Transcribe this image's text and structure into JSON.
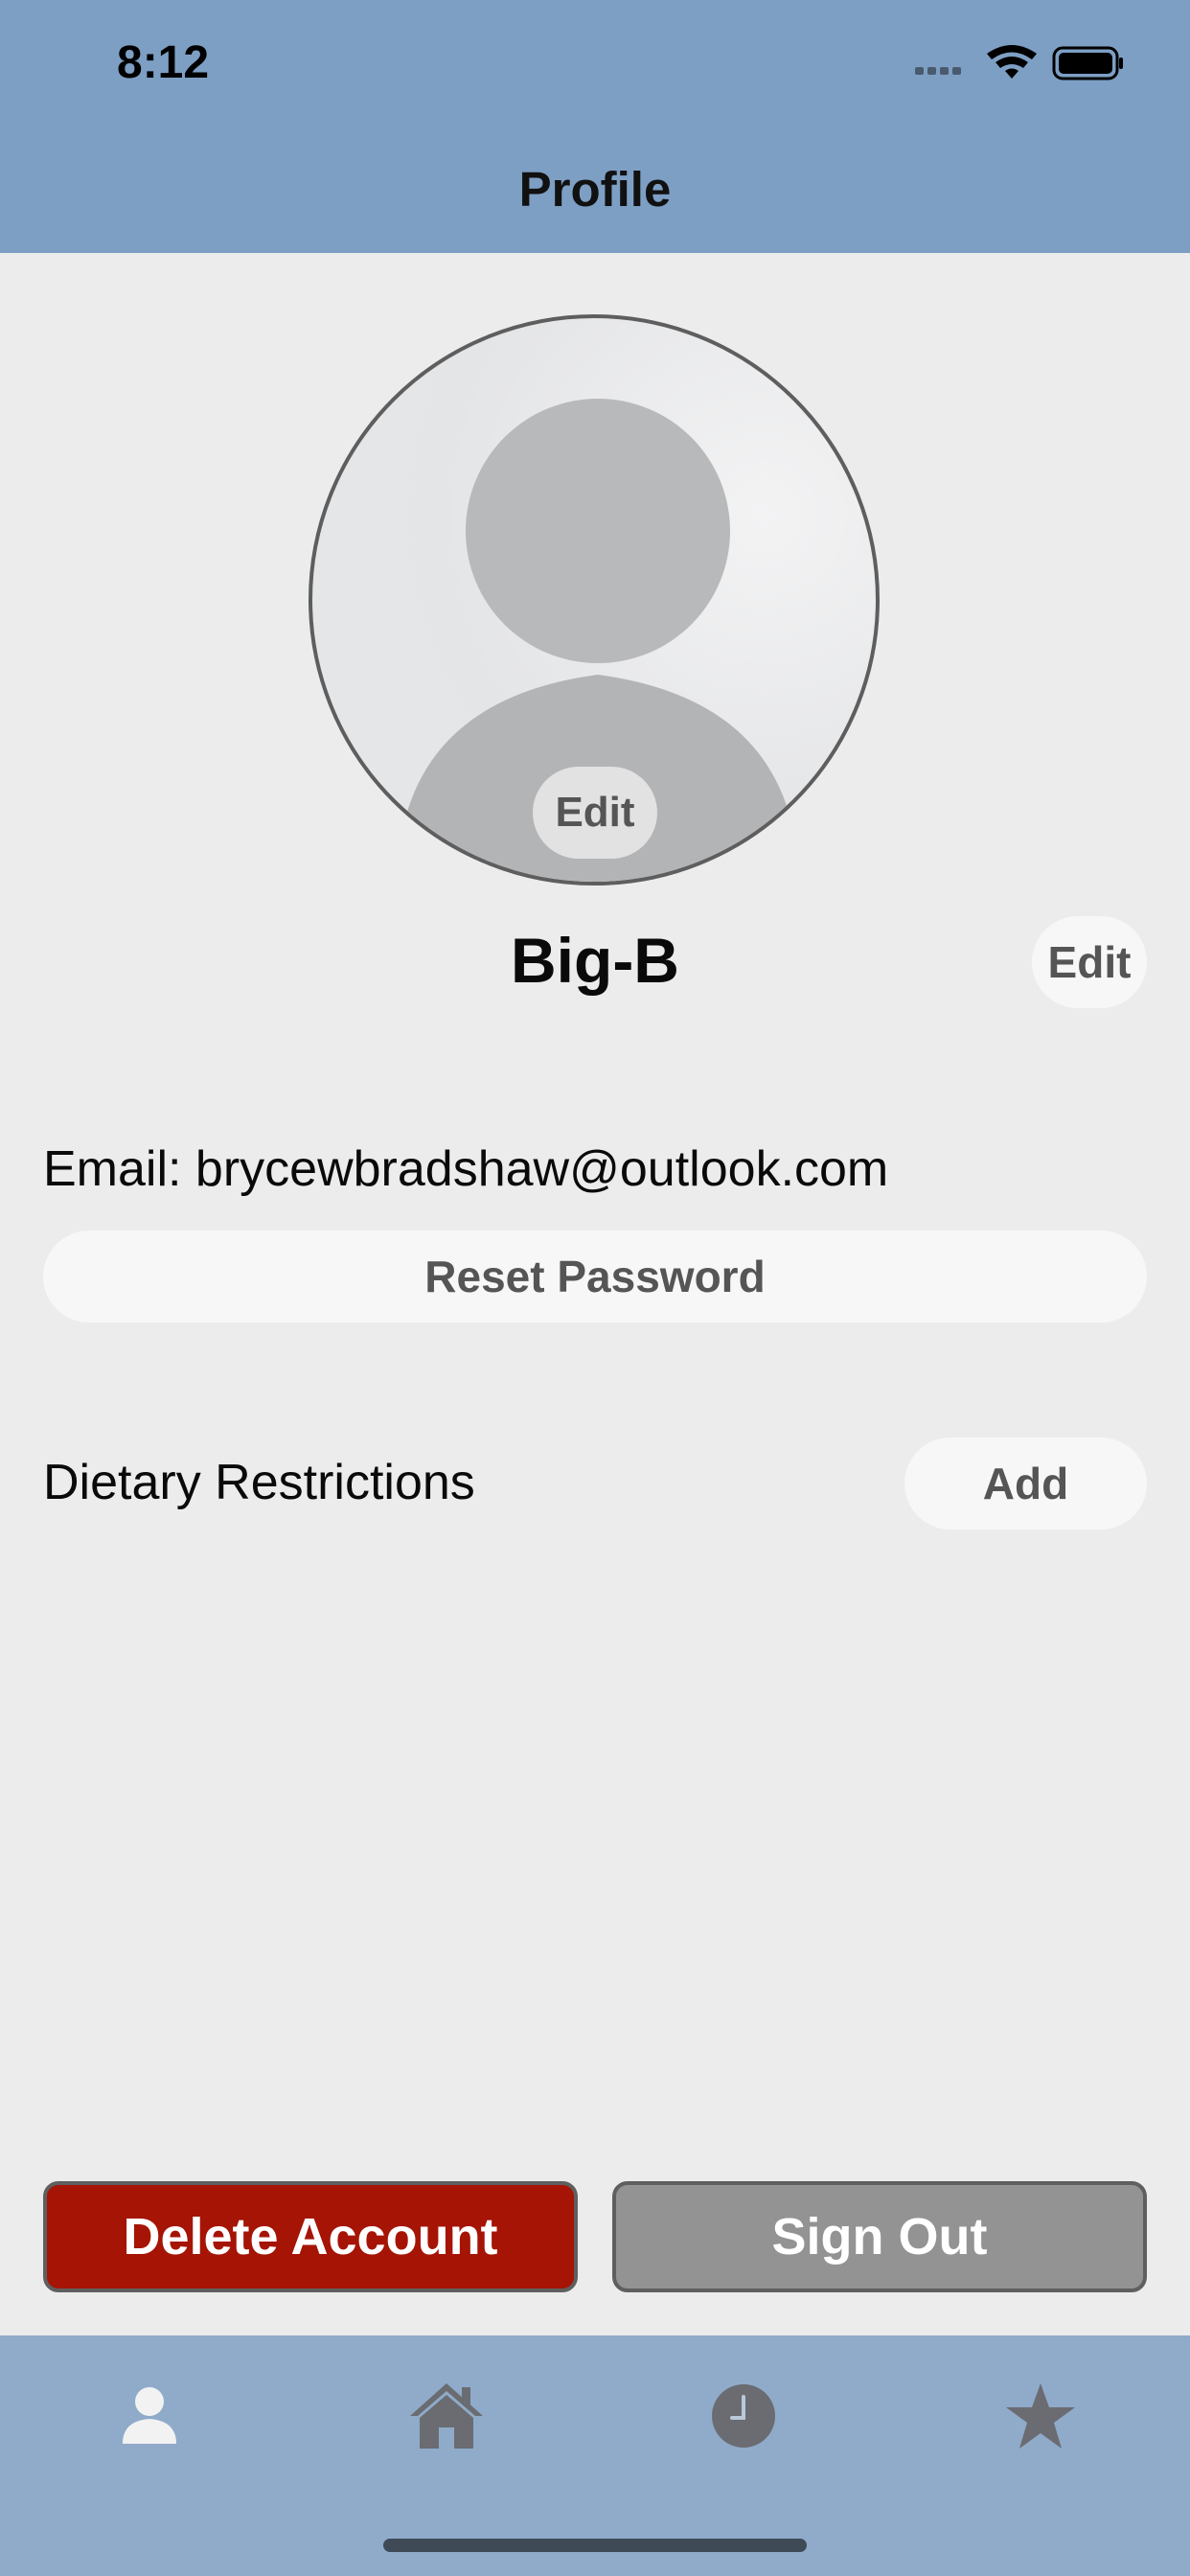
{
  "status_bar": {
    "time": "8:12"
  },
  "header": {
    "title": "Profile"
  },
  "profile": {
    "avatar_edit_label": "Edit",
    "username": "Big-B",
    "name_edit_label": "Edit",
    "email_text": "Email: brycewbradshaw@outlook.com",
    "reset_password_label": "Reset Password",
    "dietary_label": "Dietary Restrictions",
    "add_label": "Add"
  },
  "actions": {
    "delete_label": "Delete Account",
    "signout_label": "Sign Out"
  },
  "tabbar": {
    "tabs": [
      {
        "icon": "person-icon",
        "selected": true
      },
      {
        "icon": "home-icon",
        "selected": false
      },
      {
        "icon": "clock-icon",
        "selected": false
      },
      {
        "icon": "star-icon",
        "selected": false
      }
    ]
  },
  "colors": {
    "header_bg": "#7d9fc4",
    "tabbar_bg": "#8fabc9",
    "delete_bg": "#a51405",
    "signout_bg": "#939393",
    "page_bg": "#ececec"
  }
}
